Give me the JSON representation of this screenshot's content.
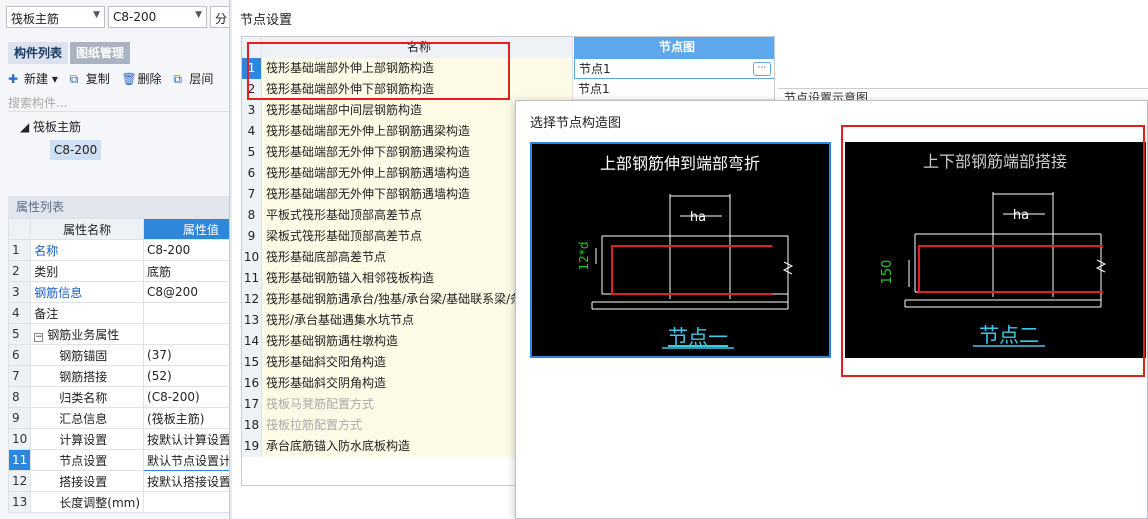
{
  "left": {
    "combo1": "筏板主筋",
    "combo2": "C8-200",
    "combo3": "分",
    "tabs": [
      "构件列表",
      "图纸管理"
    ],
    "toolbar": {
      "new": "新建",
      "copy": "复制",
      "delete": "删除",
      "layer": "层间"
    },
    "search_placeholder": "搜索构件...",
    "tree_parent": "筏板主筋",
    "tree_child": "C8-200",
    "props_section": "属性列表",
    "props_header": {
      "name": "属性名称",
      "value": "属性值"
    },
    "props": [
      {
        "n": "1",
        "name": "名称",
        "value": "C8-200"
      },
      {
        "n": "2",
        "name": "类别",
        "value": "底筋"
      },
      {
        "n": "3",
        "name": "钢筋信息",
        "value": "C8@200"
      },
      {
        "n": "4",
        "name": "备注",
        "value": ""
      },
      {
        "n": "5",
        "name": "钢筋业务属性",
        "value": ""
      },
      {
        "n": "6",
        "name": "钢筋锚固",
        "value": "(37)"
      },
      {
        "n": "7",
        "name": "钢筋搭接",
        "value": "(52)"
      },
      {
        "n": "8",
        "name": "归类名称",
        "value": "(C8-200)"
      },
      {
        "n": "9",
        "name": "汇总信息",
        "value": "(筏板主筋)"
      },
      {
        "n": "10",
        "name": "计算设置",
        "value": "按默认计算设置计算"
      },
      {
        "n": "11",
        "name": "节点设置",
        "value": "默认节点设置计算"
      },
      {
        "n": "12",
        "name": "搭接设置",
        "value": "按默认搭接设置计算"
      },
      {
        "n": "13",
        "name": "长度调整(mm)",
        "value": ""
      }
    ]
  },
  "dialog": {
    "title": "节点设置",
    "col_name": "名称",
    "col_value": "节点图",
    "rows": [
      {
        "n": "1",
        "name": "筏形基础端部外伸上部钢筋构造",
        "value": "节点1"
      },
      {
        "n": "2",
        "name": "筏形基础端部外伸下部钢筋构造",
        "value": "节点1"
      },
      {
        "n": "3",
        "name": "筏形基础端部中间层钢筋构造",
        "value": ""
      },
      {
        "n": "4",
        "name": "筏形基础端部无外伸上部钢筋遇梁构造",
        "value": ""
      },
      {
        "n": "5",
        "name": "筏形基础端部无外伸下部钢筋遇梁构造",
        "value": ""
      },
      {
        "n": "6",
        "name": "筏形基础端部无外伸上部钢筋遇墙构造",
        "value": ""
      },
      {
        "n": "7",
        "name": "筏形基础端部无外伸下部钢筋遇墙构造",
        "value": ""
      },
      {
        "n": "8",
        "name": "平板式筏形基础顶部高差节点",
        "value": ""
      },
      {
        "n": "9",
        "name": "梁板式筏形基础顶部高差节点",
        "value": ""
      },
      {
        "n": "10",
        "name": "筏形基础底部高差节点",
        "value": ""
      },
      {
        "n": "11",
        "name": "筏形基础钢筋锚入相邻筏板构造",
        "value": ""
      },
      {
        "n": "12",
        "name": "筏形基础钢筋遇承台/独基/承台梁/基础联系梁/条基构造",
        "value": ""
      },
      {
        "n": "13",
        "name": "筏形/承台基础遇集水坑节点",
        "value": ""
      },
      {
        "n": "14",
        "name": "筏形基础钢筋遇柱墩构造",
        "value": ""
      },
      {
        "n": "15",
        "name": "筏形基础斜交阳角构造",
        "value": ""
      },
      {
        "n": "16",
        "name": "筏形基础斜交阴角构造",
        "value": ""
      },
      {
        "n": "17",
        "name": "筏板马凳筋配置方式",
        "value": ""
      },
      {
        "n": "18",
        "name": "筏板拉筋配置方式",
        "value": ""
      },
      {
        "n": "19",
        "name": "承台底筋锚入防水底板构造",
        "value": ""
      }
    ],
    "preview_label": "节点设置示意图"
  },
  "popup": {
    "title": "选择节点构造图",
    "cards": [
      {
        "title": "上部钢筋伸到端部弯折",
        "dim_top": "ha",
        "dim_side": "12*d",
        "caption": "节点一"
      },
      {
        "title": "上下部钢筋端部搭接",
        "dim_top": "ha",
        "dim_side": "150",
        "caption": "节点二"
      }
    ]
  }
}
